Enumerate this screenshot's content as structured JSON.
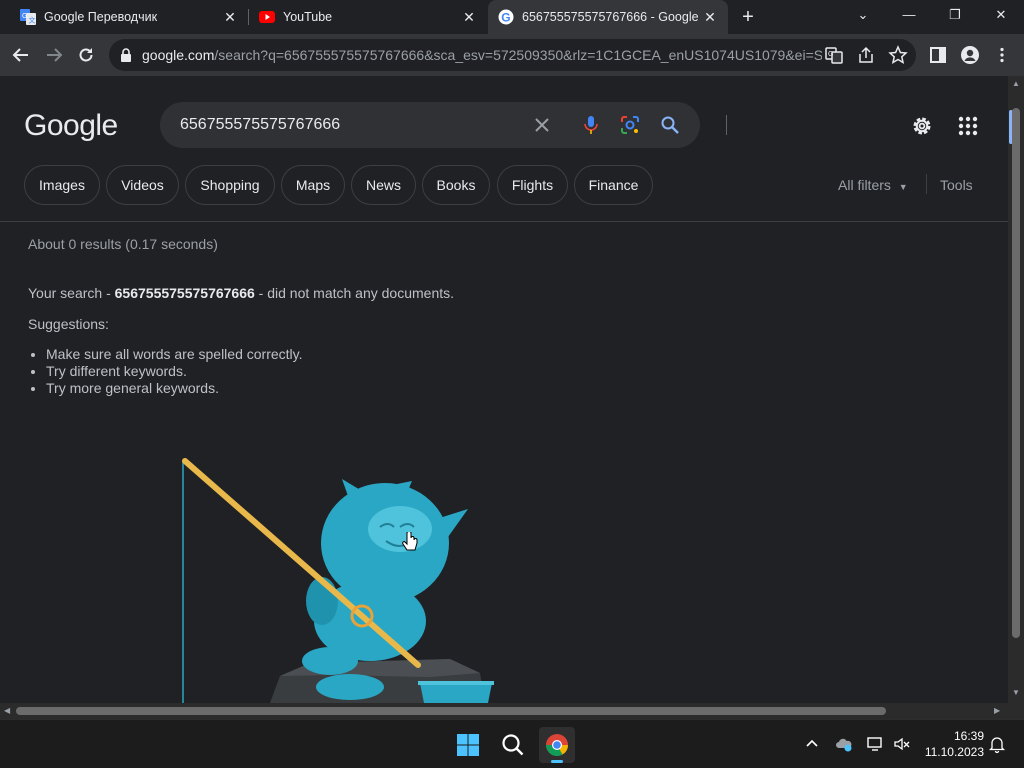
{
  "browser": {
    "tabs": [
      {
        "label": "Google Переводчик",
        "icon": "google-translate-icon",
        "active": false
      },
      {
        "label": "YouTube",
        "icon": "youtube-icon",
        "active": false
      },
      {
        "label": "656755575575767666 - Google",
        "icon": "google-icon",
        "active": true
      }
    ],
    "url_host": "google.com",
    "url_rest": "/search?q=656755575575767666&sca_esv=572509350&rlz=1C1GCEA_enUS1074US1079&ei=S..."
  },
  "search": {
    "logo": "Google",
    "query": "656755575575767666",
    "chips": [
      "Images",
      "Videos",
      "Shopping",
      "Maps",
      "News",
      "Books",
      "Flights",
      "Finance"
    ],
    "all_filters": "All filters",
    "tools": "Tools"
  },
  "results": {
    "stats": "About 0 results (0.17 seconds)",
    "no_match_prefix": "Your search - ",
    "no_match_query": "656755575575767666",
    "no_match_suffix": " - did not match any documents.",
    "suggestions_title": "Suggestions:",
    "suggestions": [
      "Make sure all words are spelled correctly.",
      "Try different keywords.",
      "Try more general keywords."
    ]
  },
  "taskbar": {
    "time": "16:39",
    "date": "11.10.2023"
  },
  "colors": {
    "page_bg": "#202124",
    "chip_border": "#3c4043",
    "creature": "#29a7c4",
    "rod": "#e8b84a"
  }
}
